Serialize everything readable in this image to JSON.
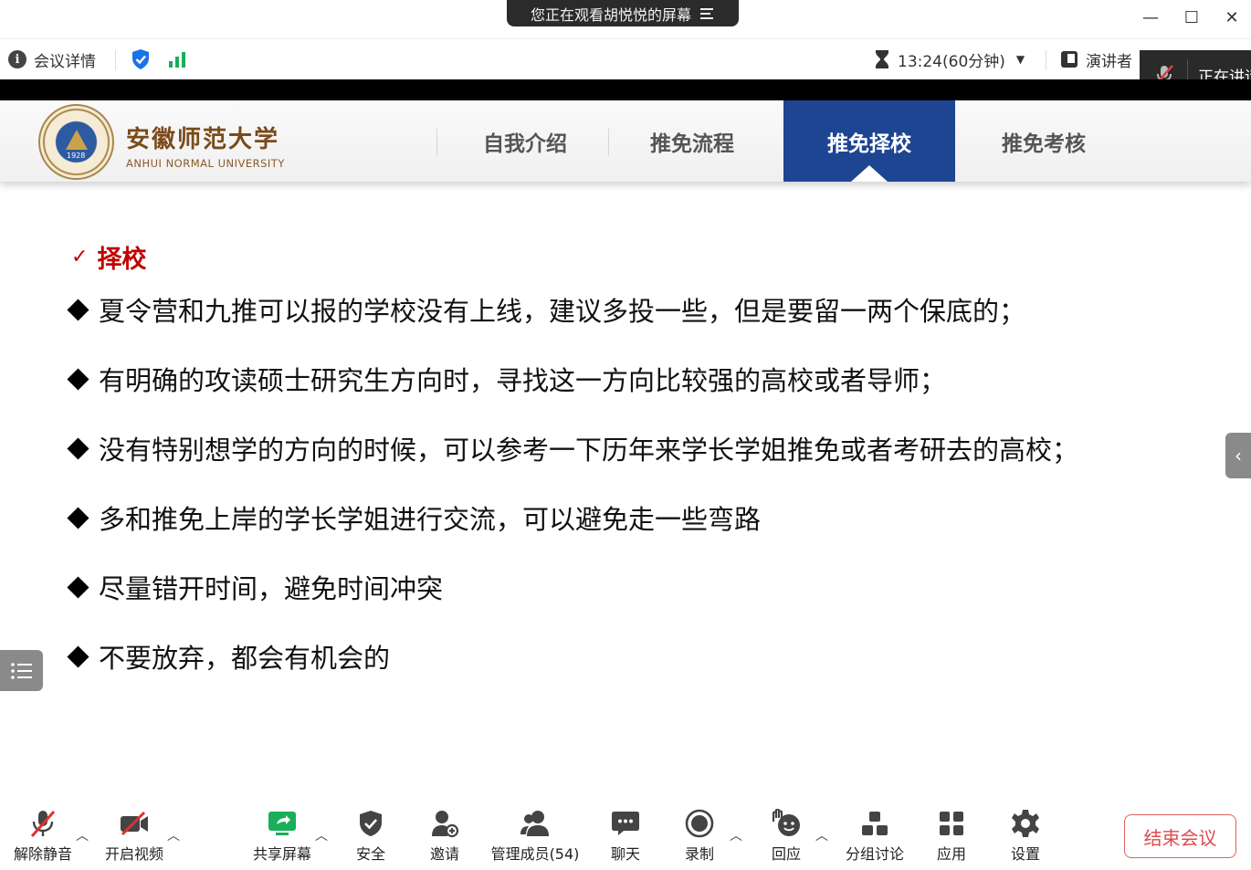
{
  "titlebar": {
    "share_notice": "您正在观看胡悦悦的屏幕",
    "minimize": "—",
    "maximize": "☐",
    "close": "✕"
  },
  "infobar": {
    "meeting_details": "会议详情",
    "timer": "13:24(60分钟)",
    "speaker_view": "演讲者"
  },
  "speaking": {
    "label": "正在讲话"
  },
  "slide": {
    "university_cn": "安徽师范大学",
    "university_en": "ANHUI NORMAL UNIVERSITY",
    "seal_year": "1928",
    "tabs": [
      {
        "label": "自我介绍",
        "active": false
      },
      {
        "label": "推免流程",
        "active": false
      },
      {
        "label": "推免择校",
        "active": true
      },
      {
        "label": "推免考核",
        "active": false
      }
    ],
    "section_title": "择校",
    "bullets": [
      "夏令营和九推可以报的学校没有上线，建议多投一些，但是要留一两个保底的；",
      "有明确的攻读硕士研究生方向时，寻找这一方向比较强的高校或者导师；",
      "没有特别想学的方向的时候，可以参考一下历年来学长学姐推免或者考研去的高校；",
      "多和推免上岸的学长学姐进行交流，可以避免走一些弯路",
      "尽量错开时间，避免时间冲突",
      "不要放弃，都会有机会的"
    ]
  },
  "toolbar": {
    "unmute": "解除静音",
    "start_video": "开启视频",
    "share_screen": "共享屏幕",
    "security": "安全",
    "invite": "邀请",
    "manage_members": "管理成员(54)",
    "chat": "聊天",
    "record": "录制",
    "reactions": "回应",
    "breakout": "分组讨论",
    "apps": "应用",
    "settings": "设置",
    "end_meeting": "结束会议"
  },
  "colors": {
    "accent_blue": "#1e4592",
    "title_red": "#c00000",
    "share_green": "#1aad5a",
    "end_red": "#e04a4a"
  }
}
